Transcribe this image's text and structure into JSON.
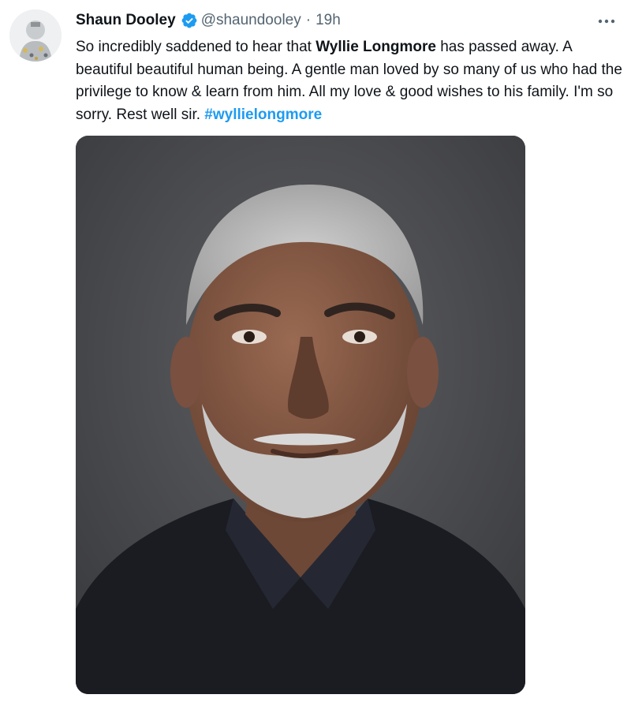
{
  "tweet": {
    "author": {
      "display_name": "Shaun Dooley",
      "handle": "@shaundooley",
      "verified": true,
      "avatar_icon": "avatar-image"
    },
    "separator": "·",
    "timestamp": "19h",
    "more_icon": "more-horizontal-icon",
    "text": {
      "part1": "So incredibly saddened to hear that ",
      "bold_name": "Wyllie Longmore",
      "part2": " has passed away. A beautiful beautiful human being. A gentle man loved by so many of us who had the privilege to know & learn from him. All my love & good wishes to his family. I'm so sorry. Rest well sir. ",
      "hashtag": "#wyllielongmore"
    },
    "media": {
      "type": "photo"
    }
  },
  "colors": {
    "text_primary": "#0f1419",
    "text_secondary": "#536471",
    "accent": "#1d9bf0",
    "background": "#ffffff"
  }
}
